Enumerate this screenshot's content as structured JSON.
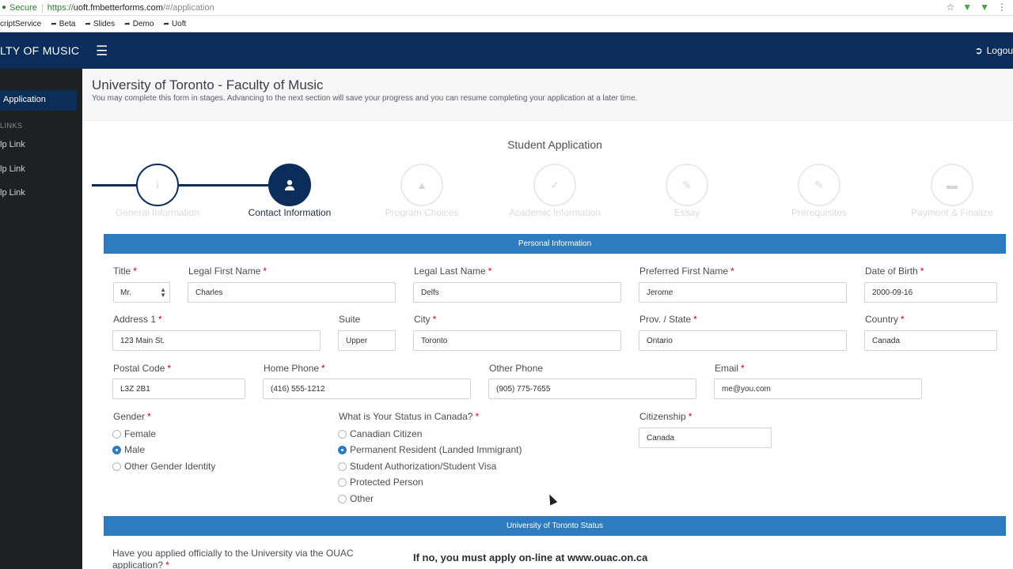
{
  "browser": {
    "secure_label": "Secure",
    "url_protocol": "https://",
    "url_host": "uoft.fmbetterforms.com",
    "url_path": "/#/application",
    "bookmarks": [
      "criptService",
      "Beta",
      "Slides",
      "Demo",
      "Uoft"
    ]
  },
  "header": {
    "brand": "LTY OF MUSIC",
    "logout_label": "Logou"
  },
  "sidebar": {
    "active_item": "Application",
    "links_title": "LINKS",
    "links": [
      "lp Link",
      "lp Link",
      "lp Link"
    ]
  },
  "page": {
    "title": "University of Toronto - Faculty of Music",
    "subtitle": "You may complete this form in stages. Advancing to the next section will save your progress and you can resume completing your application at a later time.",
    "form_title": "Student Application"
  },
  "steps": [
    {
      "label": "General Information",
      "icon": "i"
    },
    {
      "label": "Contact Information",
      "icon": "user"
    },
    {
      "label": "Program Choices",
      "icon": "graduation-cap"
    },
    {
      "label": "Academic Information",
      "icon": "check"
    },
    {
      "label": "Essay",
      "icon": "pencil"
    },
    {
      "label": "Prerequisites",
      "icon": "pencil"
    },
    {
      "label": "Payment & Finalize",
      "icon": "credit-card"
    }
  ],
  "personal": {
    "section_title": "Personal Information",
    "title_label": "Title",
    "title_value": "Mr.",
    "first_name_label": "Legal First Name",
    "first_name": "Charles",
    "last_name_label": "Legal Last Name",
    "last_name": "Delfs",
    "preferred_label": "Preferred First Name",
    "preferred": "Jerome",
    "dob_label": "Date of Birth",
    "dob": "2000-09-16",
    "address_label": "Address 1",
    "address": "123 Main St.",
    "suite_label": "Suite",
    "suite": "Upper",
    "city_label": "City",
    "city": "Toronto",
    "prov_label": "Prov. / State",
    "prov": "Ontario",
    "country_label": "Country",
    "country": "Canada",
    "postal_label": "Postal Code",
    "postal": "L3Z 2B1",
    "home_phone_label": "Home Phone",
    "home_phone": "(416) 555-1212",
    "other_phone_label": "Other Phone",
    "other_phone": "(905) 775-7655",
    "email_label": "Email",
    "email": "me@you.com",
    "gender_label": "Gender",
    "gender_options": [
      "Female",
      "Male",
      "Other Gender Identity"
    ],
    "gender_selected": "Male",
    "status_label": "What is Your Status in Canada?",
    "status_options": [
      "Canadian Citizen",
      "Permanent Resident (Landed Immigrant)",
      "Student Authorization/Student Visa",
      "Protected Person",
      "Other"
    ],
    "status_selected": "Permanent Resident (Landed Immigrant)",
    "citizenship_label": "Citizenship",
    "citizenship": "Canada"
  },
  "uoft_status": {
    "section_title": "University of Toronto Status",
    "question": "Have you applied officially to the University via the OUAC application?",
    "note": "If no, you must apply on-line at www.ouac.on.ca"
  },
  "colors": {
    "navy": "#0b2d5b",
    "section_blue": "#2e7bbf",
    "required_red": "#d0021b"
  }
}
